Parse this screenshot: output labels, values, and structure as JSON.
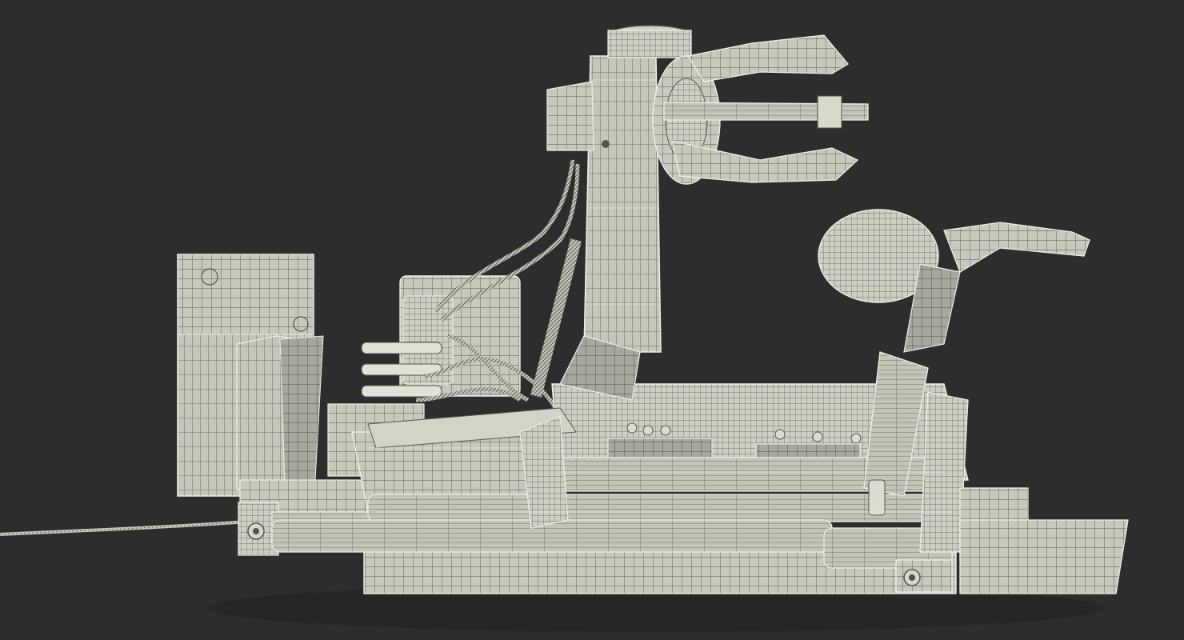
{
  "scene": {
    "subject": "tire-changer-machine-wireframe",
    "colors": {
      "background": "#2d2d2d",
      "model_fill": "#c9c8bd",
      "model_shade": "#9f9e94",
      "wire_dark": "#55554e",
      "wire_light": "#efeee6"
    }
  }
}
